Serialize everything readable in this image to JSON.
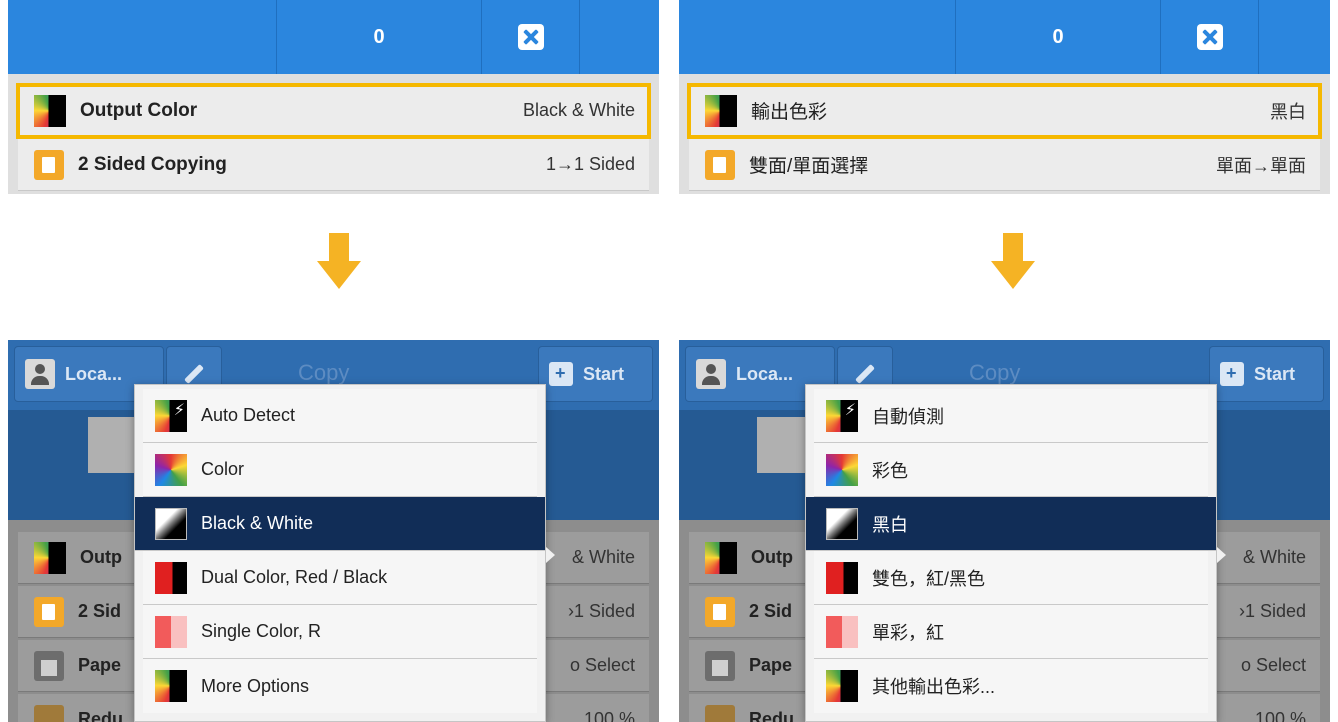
{
  "top_left": {
    "count": "0",
    "rows": [
      {
        "label": "Output Color",
        "value": "Black & White"
      },
      {
        "label": "2 Sided Copying",
        "value": "1→1 Sided"
      }
    ]
  },
  "top_right": {
    "count": "0",
    "rows": [
      {
        "label": "輸出色彩",
        "value": "黑白"
      },
      {
        "label": "雙面/單面選擇",
        "value": "單面→單面"
      }
    ]
  },
  "bottom_left": {
    "user_label": "Loca...",
    "title": "Copy",
    "start_label": "Start",
    "bg_rows": [
      {
        "label": "Outp",
        "value": "& White"
      },
      {
        "label": "2 Sid",
        "value": "›1 Sided"
      },
      {
        "label": "Pape",
        "value": "o Select"
      },
      {
        "label": "Redu",
        "value": "100 %"
      }
    ],
    "menu": [
      {
        "label": "Auto Detect",
        "icon": "auto-detect-icon"
      },
      {
        "label": "Color",
        "icon": "color-icon"
      },
      {
        "label": "Black & White",
        "icon": "black-white-icon",
        "selected": true
      },
      {
        "label": "Dual Color, Red / Black",
        "icon": "dual-color-icon"
      },
      {
        "label": "Single Color, R",
        "icon": "single-color-icon"
      },
      {
        "label": "More Options",
        "icon": "more-options-icon"
      }
    ]
  },
  "bottom_right": {
    "user_label": "Loca...",
    "title": "Copy",
    "start_label": "Start",
    "bg_rows": [
      {
        "label": "Outp",
        "value": "& White"
      },
      {
        "label": "2 Sid",
        "value": "›1 Sided"
      },
      {
        "label": "Pape",
        "value": "o Select"
      },
      {
        "label": "Redu",
        "value": "100 %"
      }
    ],
    "menu": [
      {
        "label": "自動偵測",
        "icon": "auto-detect-icon"
      },
      {
        "label": "彩色",
        "icon": "color-icon"
      },
      {
        "label": "黑白",
        "icon": "black-white-icon",
        "selected": true
      },
      {
        "label": "雙色，紅/黑色",
        "icon": "dual-color-icon"
      },
      {
        "label": "單彩，紅",
        "icon": "single-color-icon"
      },
      {
        "label": "其他輸出色彩...",
        "icon": "more-options-icon"
      }
    ]
  },
  "colors": {
    "accent_blue": "#2b86de",
    "highlight_yellow": "#f5b800",
    "arrow_orange": "#f5b324",
    "selected_navy": "#112d57"
  }
}
